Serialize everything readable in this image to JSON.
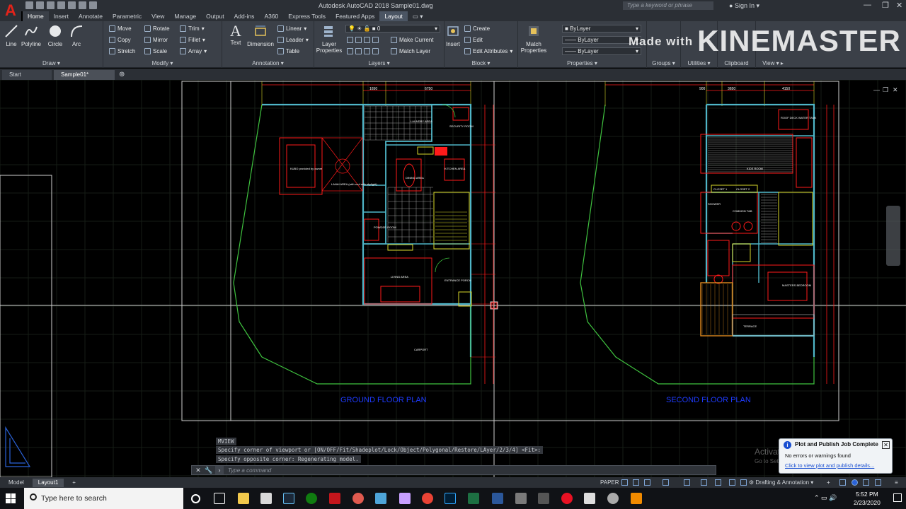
{
  "titlebar": {
    "app_letter": "A",
    "title": "Autodesk AutoCAD 2018   Sample01.dwg",
    "search_placeholder": "Type a keyword or phrase",
    "signin": "Sign In"
  },
  "ribbon_tabs": [
    "Home",
    "Insert",
    "Annotate",
    "Parametric",
    "View",
    "Manage",
    "Output",
    "Add-ins",
    "A360",
    "Express Tools",
    "Featured Apps",
    "Layout"
  ],
  "draw": {
    "tools": [
      "Line",
      "Polyline",
      "Circle",
      "Arc"
    ],
    "label": "Draw"
  },
  "modify": {
    "tools": [
      "Move",
      "Rotate",
      "Trim",
      "Copy",
      "Mirror",
      "Fillet",
      "Stretch",
      "Scale",
      "Array"
    ],
    "label": "Modify"
  },
  "annotation": {
    "big": [
      "Text",
      "Dimension"
    ],
    "small": [
      "Linear",
      "Leader",
      "Table"
    ],
    "label": "Annotation"
  },
  "layers": {
    "big": "Layer Properties",
    "layer_value": "0",
    "small": [
      "Make Current",
      "Match Layer"
    ],
    "label": "Layers"
  },
  "block": {
    "big": "Insert",
    "small": [
      "Create",
      "Edit",
      "Edit Attributes"
    ],
    "label": "Block"
  },
  "properties": {
    "big": "Match Properties",
    "combos": [
      "ByLayer",
      "ByLayer",
      "ByLayer"
    ],
    "label": "Properties"
  },
  "right_panels": [
    "Groups",
    "Utilities",
    "Clipboard",
    "View"
  ],
  "watermark": {
    "small": "Made with",
    "big": "KINEMASTER"
  },
  "file_tabs": [
    "Start",
    "Sample01*"
  ],
  "drawing": {
    "ground_title": "GROUND FLOOR PLAN",
    "second_title": "SECOND FLOOR PLAN",
    "ground_dims": [
      "1650",
      "6750"
    ],
    "second_dims": [
      "900",
      "3650",
      "4150"
    ],
    "ground_rooms": [
      "LAUNDRY AREA",
      "SECURITY ROOM",
      "DINING AREA",
      "KITCHEN AREA",
      "POWDER ROOM",
      "LIVING AREA",
      "ENTRANCE PORCH",
      "LANAI AREA (with roof with skylight)",
      "KUBO provided by owner",
      "CARPORT"
    ],
    "second_rooms": [
      "ROOF DECK WATER TANK",
      "KIDS ROOM",
      "CLOSET 1",
      "CLOSET 2",
      "SHOWER",
      "COMMON T&B",
      "MASTERS BEDROOM",
      "TERRACE"
    ],
    "colors": {
      "wall": "#4fb6c8",
      "red": "#ff1a1a",
      "green": "#3fc23f",
      "yellow": "#d8d82a",
      "grid": "#1a2a1a",
      "title": "#1e3bff"
    }
  },
  "command": {
    "history": [
      "MVIEW",
      "Specify corner of viewport or [ON/OFF/Fit/Shadeplot/Lock/Object/Polygonal/Restore/LAyer/2/3/4] <Fit>:",
      "Specify opposite corner: Regenerating model."
    ],
    "placeholder": "Type a command"
  },
  "notification": {
    "title": "Plot and Publish Job Complete",
    "message": "No errors or warnings found",
    "link": "Click to view plot and publish details..."
  },
  "activate": {
    "line1": "Activate Windows",
    "line2": "Go to Settings to activate Windows."
  },
  "status": {
    "tabs": [
      "Model",
      "Layout1"
    ],
    "paper": "PAPER",
    "workspace": "Drafting & Annotation"
  },
  "taskbar": {
    "search_placeholder": "Type here to search",
    "time": "5:52 PM",
    "date": "2/23/2020"
  }
}
